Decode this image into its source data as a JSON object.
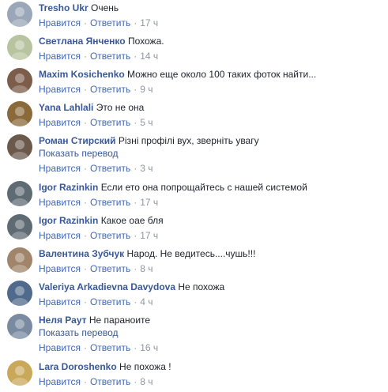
{
  "comments": [
    {
      "author": "Tresho Ukr",
      "text": "Очень",
      "like": "Нравится",
      "reply": "Ответить",
      "sep": "·",
      "time": "17 ч",
      "avatar_color": "#9aa7b8"
    },
    {
      "author": "Светлана Янченко",
      "text": "Похожа.",
      "like": "Нравится",
      "reply": "Ответить",
      "sep": "·",
      "time": "14 ч",
      "avatar_color": "#b8c4a0"
    },
    {
      "author": "Maxim Kosichenko",
      "text": "Можно еще около 100 таких фоток найти...",
      "like": "Нравится",
      "reply": "Ответить",
      "sep": "·",
      "time": "9 ч",
      "avatar_color": "#7b5d4a"
    },
    {
      "author": "Yana Lahlali",
      "text": "Это не она",
      "like": "Нравится",
      "reply": "Ответить",
      "sep": "·",
      "time": "5 ч",
      "avatar_color": "#8a6a3a"
    },
    {
      "author": "Роман Стирский",
      "text": "Різні профілі вух, зверніть увагу",
      "translate": "Показать перевод",
      "like": "Нравится",
      "reply": "Ответить",
      "sep": "·",
      "time": "3 ч",
      "avatar_color": "#6b5a4c"
    },
    {
      "author": "Igor Razinkin",
      "text": "Если ето она попрощайтесь с нашей системой",
      "like": "Нравится",
      "reply": "Ответить",
      "sep": "·",
      "time": "17 ч",
      "avatar_color": "#5e6b73"
    },
    {
      "author": "Igor Razinkin",
      "text": "Какое оае бля",
      "like": "Нравится",
      "reply": "Ответить",
      "sep": "·",
      "time": "17 ч",
      "avatar_color": "#5e6b73"
    },
    {
      "author": "Валентина Зубчук",
      "text": "Народ. Не ведитесь....чушь!!!",
      "like": "Нравится",
      "reply": "Ответить",
      "sep": "·",
      "time": "8 ч",
      "avatar_color": "#a0856a"
    },
    {
      "author": "Valeriya Arkadievna Davydova",
      "text": "Не похожа",
      "like": "Нравится",
      "reply": "Ответить",
      "sep": "·",
      "time": "4 ч",
      "avatar_color": "#4f6a8a"
    },
    {
      "author": "Неля Раут",
      "text": "Не параноите",
      "translate": "Показать перевод",
      "like": "Нравится",
      "reply": "Ответить",
      "sep": "·",
      "time": "16 ч",
      "avatar_color": "#7a8aa0"
    },
    {
      "author": "Lara Doroshenko",
      "text": "Не похожа !",
      "like": "Нравится",
      "reply": "Ответить",
      "sep": "·",
      "time": "8 ч",
      "avatar_color": "#c9a85a"
    }
  ]
}
